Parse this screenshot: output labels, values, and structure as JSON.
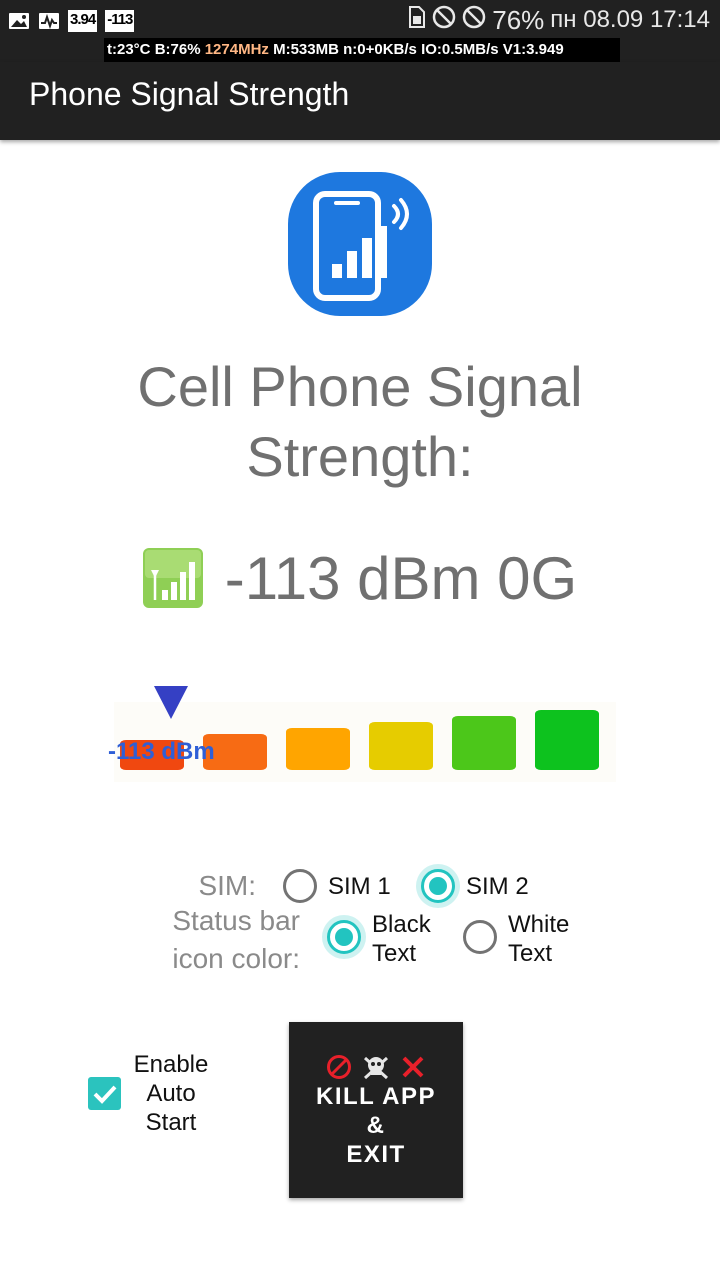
{
  "status_bar": {
    "left_icons": [
      "image-icon",
      "activity-icon"
    ],
    "badge_value_1": "3.94",
    "badge_value_2": "-113",
    "right_icons": [
      "sim-icon",
      "do-not-disturb-icon",
      "blocked-icon"
    ],
    "battery": "76%",
    "date_time": "пн 08.09 17:14"
  },
  "system_overlay": {
    "temp": "t:23°C",
    "battery": "B:76%",
    "cpu": "1274MHz",
    "memory": "M:533MB",
    "network": "n:0+0KB/s",
    "io": "IO:0.5MB/s",
    "version": "V1:3.949"
  },
  "app_bar": {
    "title": "Phone Signal Strength"
  },
  "heading": "Cell Phone Signal Strength:",
  "signal": {
    "reading": "-113 dBm 0G",
    "icon": "signal-bars-icon"
  },
  "meter": {
    "label": "-113 dBm",
    "current_level": 0,
    "bar_colors": [
      "#f04810",
      "#f76b14",
      "#ffa500",
      "#e6cc00",
      "#4cc71a",
      "#0dc21e"
    ]
  },
  "sim": {
    "label": "SIM:",
    "options": [
      "SIM 1",
      "SIM 2"
    ],
    "selected": "SIM 2"
  },
  "status_icon_color": {
    "label": "Status bar icon color:",
    "options": [
      "Black Text",
      "White Text"
    ],
    "selected": "Black Text"
  },
  "auto_start": {
    "label": "Enable Auto Start",
    "checked": true
  },
  "kill_button": {
    "icons": [
      "prohibited-icon",
      "skull-crossbones-icon",
      "cross-mark-icon"
    ],
    "label": "KILL APP\n&\nEXIT"
  },
  "colors": {
    "bar_dark": "#212121",
    "accent_teal": "#22c4c0",
    "logo_blue": "#1e78df",
    "text_gray": "#707070"
  }
}
